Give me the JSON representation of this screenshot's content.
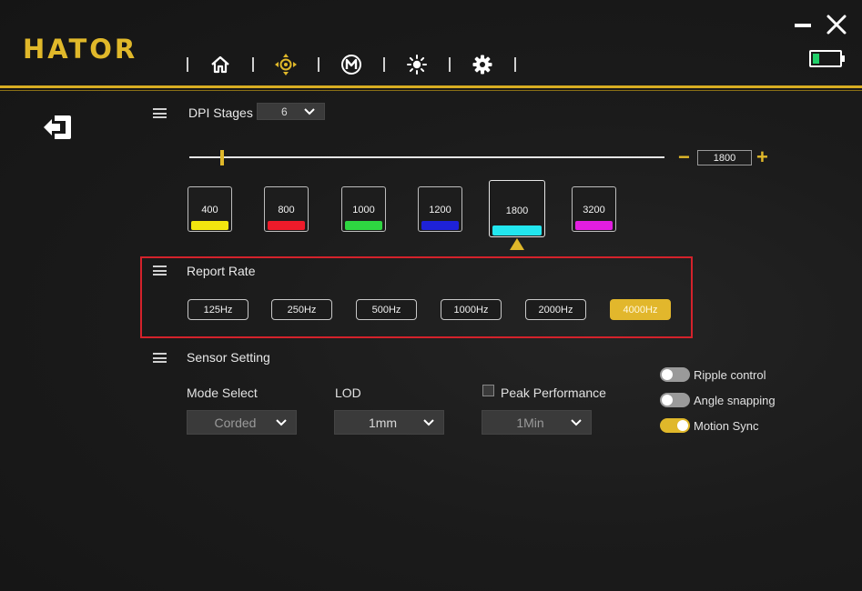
{
  "app": {
    "brand": "HATOR"
  },
  "nav": {
    "items": [
      {
        "name": "home",
        "icon": "home-icon"
      },
      {
        "name": "dpi",
        "icon": "crosshair-icon",
        "active": true
      },
      {
        "name": "macro",
        "icon": "macro-m-icon"
      },
      {
        "name": "lighting",
        "icon": "sun-icon"
      },
      {
        "name": "settings",
        "icon": "gear-icon"
      }
    ]
  },
  "battery": {
    "level": 0.25,
    "color": "#22d06a"
  },
  "colors": {
    "accent": "#e0b82a",
    "highlight_border": "#d4222b"
  },
  "dpi": {
    "title": "DPI Stages",
    "stages_count": "6",
    "current_value": "1800",
    "minus_label": "−",
    "plus_label": "+",
    "stages": [
      {
        "value": "400",
        "color": "#f2e60f"
      },
      {
        "value": "800",
        "color": "#ee1b2a"
      },
      {
        "value": "1000",
        "color": "#2ed641"
      },
      {
        "value": "1200",
        "color": "#1e22d8"
      },
      {
        "value": "1800",
        "color": "#22e6ee",
        "selected": true
      },
      {
        "value": "3200",
        "color": "#e21ee0"
      }
    ]
  },
  "report_rate": {
    "title": "Report Rate",
    "options": [
      "125Hz",
      "250Hz",
      "500Hz",
      "1000Hz",
      "2000Hz",
      "4000Hz"
    ],
    "selected": "4000Hz"
  },
  "sensor": {
    "title": "Sensor Setting",
    "mode_label": "Mode Select",
    "mode_value": "Corded",
    "lod_label": "LOD",
    "lod_value": "1mm",
    "peak_label": "Peak Performance",
    "peak_checked": false,
    "peak_value": "1Min",
    "toggles": [
      {
        "label": "Ripple control",
        "on": false
      },
      {
        "label": "Angle snapping",
        "on": false
      },
      {
        "label": "Motion Sync",
        "on": true
      }
    ]
  }
}
